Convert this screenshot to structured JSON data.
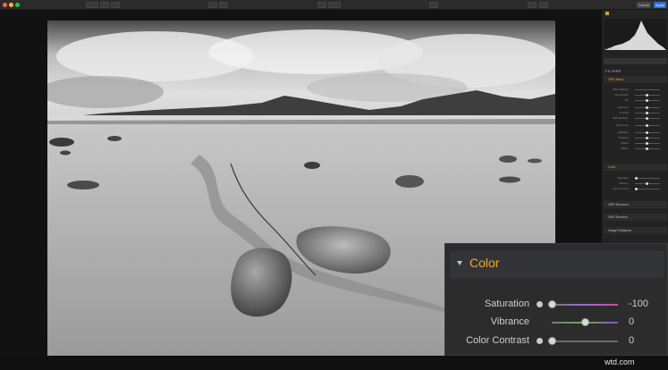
{
  "toolbar": {
    "title": "",
    "cancel_label": "Cancel",
    "apply_label": "Apply"
  },
  "panel": {
    "layers_label": "LAYERS",
    "filters_label": "FILTERS",
    "sections": [
      "HDR Basic",
      "Color",
      "HDR Structure",
      "HDR Denoise",
      "Image Radiance"
    ],
    "hdr_basic_rows": [
      "White Balance",
      "Temperature",
      "Tint",
      "Exposure",
      "Contrast",
      "HDR Enhance",
      "Smart Tone",
      "Highlights",
      "Shadows",
      "Whites",
      "Blacks"
    ],
    "color_rows": [
      "Saturation",
      "Vibrance",
      "Color Contrast"
    ]
  },
  "color_panel": {
    "title": "Color",
    "rows": [
      {
        "label": "Saturation",
        "value": "-100",
        "level": -100
      },
      {
        "label": "Vibrance",
        "value": "0",
        "level": 0
      },
      {
        "label": "Color Contrast",
        "value": "0",
        "level": 0
      }
    ]
  },
  "watermark": "wtd.com",
  "colors": {
    "accent": "#f5a82b",
    "apply": "#2a6fd6"
  }
}
